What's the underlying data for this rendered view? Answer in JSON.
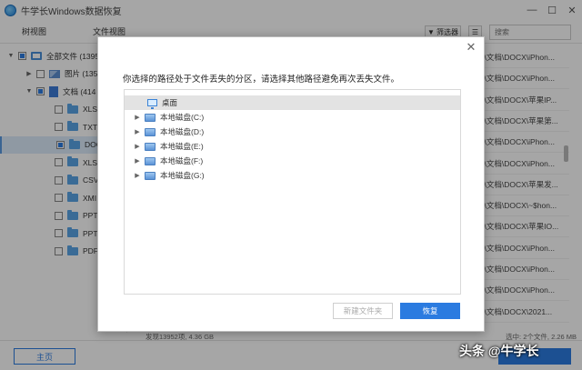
{
  "app": {
    "title": "牛学长Windows数据恢复"
  },
  "window_controls": [
    "—",
    "☐",
    "✕"
  ],
  "tabs": {
    "tree": "树视图",
    "file": "文件视图"
  },
  "toolbar": {
    "filter_label": "筛选器",
    "search_placeholder": "搜索"
  },
  "tree": [
    {
      "label": "全部文件 (1395",
      "level": 0,
      "caret": "▼",
      "check": "partial",
      "icon": "computer-icon"
    },
    {
      "label": "图片 (135",
      "level": 1,
      "caret": "▶",
      "check": "none",
      "icon": "image-icon"
    },
    {
      "label": "文档 (414",
      "level": 1,
      "caret": "▼",
      "check": "partial",
      "icon": "document-icon"
    },
    {
      "label": "XLS",
      "level": 2,
      "caret": "",
      "check": "none",
      "icon": "folder-icon"
    },
    {
      "label": "TXT",
      "level": 2,
      "caret": "",
      "check": "none",
      "icon": "folder-icon"
    },
    {
      "label": "DOC",
      "level": 2,
      "caret": "",
      "check": "partial",
      "icon": "folder-icon",
      "selected": true
    },
    {
      "label": "XLS",
      "level": 2,
      "caret": "",
      "check": "none",
      "icon": "folder-icon"
    },
    {
      "label": "CSV",
      "level": 2,
      "caret": "",
      "check": "none",
      "icon": "folder-icon"
    },
    {
      "label": "XMI",
      "level": 2,
      "caret": "",
      "check": "none",
      "icon": "folder-icon"
    },
    {
      "label": "PPT",
      "level": 2,
      "caret": "",
      "check": "none",
      "icon": "folder-icon"
    },
    {
      "label": "PPT",
      "level": 2,
      "caret": "",
      "check": "none",
      "icon": "folder-icon"
    },
    {
      "label": "PDF",
      "level": 2,
      "caret": "",
      "check": "none",
      "icon": "folder-icon"
    }
  ],
  "paths": [
    "件\\文档\\DOCX\\iPhon...",
    "件\\文档\\DOCX\\iPhon...",
    "件\\文档\\DOCX\\苹果IP...",
    "件\\文档\\DOCX\\苹果第...",
    "件\\文档\\DOCX\\iPhon...",
    "件\\文档\\DOCX\\iPhon...",
    "件\\文档\\DOCX\\苹果发...",
    "件\\文档\\DOCX\\~$hon...",
    "件\\文档\\DOCX\\苹果IO...",
    "件\\文档\\DOCX\\iPhon...",
    "件\\文档\\DOCX\\iPhon...",
    "件\\文档\\DOCX\\iPhon...",
    "件\\文档\\DOCX\\2021..."
  ],
  "status": {
    "found": "发现13952项, 4.36 GB",
    "selected": "选中: 2个文件, 2.26 MB"
  },
  "bottom": {
    "home_label": "主页"
  },
  "watermark": "头条 @牛学长",
  "dialog": {
    "message": "你选择的路径处于文件丢失的分区，请选择其他路径避免再次丢失文件。",
    "close_glyph": "✕",
    "folders": [
      {
        "label": "桌面",
        "type": "desktop",
        "selected": true
      },
      {
        "label": "本地磁盘(C:)",
        "type": "disk"
      },
      {
        "label": "本地磁盘(D:)",
        "type": "disk"
      },
      {
        "label": "本地磁盘(E:)",
        "type": "disk"
      },
      {
        "label": "本地磁盘(F:)",
        "type": "disk"
      },
      {
        "label": "本地磁盘(G:)",
        "type": "disk"
      }
    ],
    "new_folder_label": "新建文件夹",
    "restore_label": "恢复"
  },
  "colors": {
    "accent": "#2b7be0",
    "overlay": "rgba(0,0,0,0.35)"
  }
}
